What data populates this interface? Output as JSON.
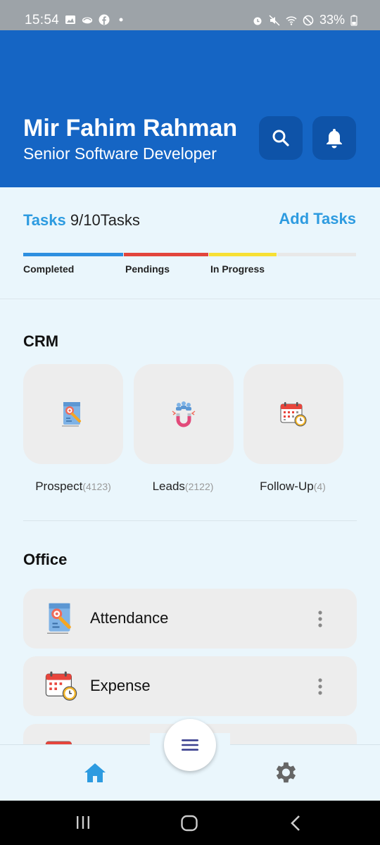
{
  "status_bar": {
    "time": "15:54",
    "battery": "33%",
    "left_icons": [
      "image-icon",
      "cloud-icon",
      "facebook-icon",
      "dot-icon"
    ],
    "right_icons": [
      "alarm-icon",
      "mute-icon",
      "wifi-icon",
      "dnd-icon",
      "battery-icon"
    ]
  },
  "header": {
    "name": "Mir Fahim Rahman",
    "role": "Senior Software Developer",
    "bg_color": "#1565C4"
  },
  "tasks": {
    "title": "Tasks",
    "count": "9/10Tasks",
    "add_label": "Add Tasks",
    "progress": [
      {
        "label": "Completed",
        "color": "#2D8FE0"
      },
      {
        "label": "Pendings",
        "color": "#E2453C"
      },
      {
        "label": "In Progress",
        "color": "#F7E034"
      }
    ]
  },
  "crm": {
    "title": "CRM",
    "items": [
      {
        "label": "Prospect",
        "count": "(4123)",
        "icon": "prospect-icon"
      },
      {
        "label": "Leads",
        "count": "(2122)",
        "icon": "leads-magnet-icon"
      },
      {
        "label": "Follow-Up",
        "count": "(4)",
        "icon": "calendar-clock-icon"
      }
    ]
  },
  "office": {
    "title": "Office",
    "items": [
      {
        "label": "Attendance",
        "icon": "attendance-icon"
      },
      {
        "label": "Expense",
        "icon": "calendar-clock-icon"
      }
    ]
  },
  "bottom_nav": {
    "items": [
      "home-icon",
      "menu-icon",
      "settings-icon"
    ],
    "accent": "#2D9BE0"
  }
}
